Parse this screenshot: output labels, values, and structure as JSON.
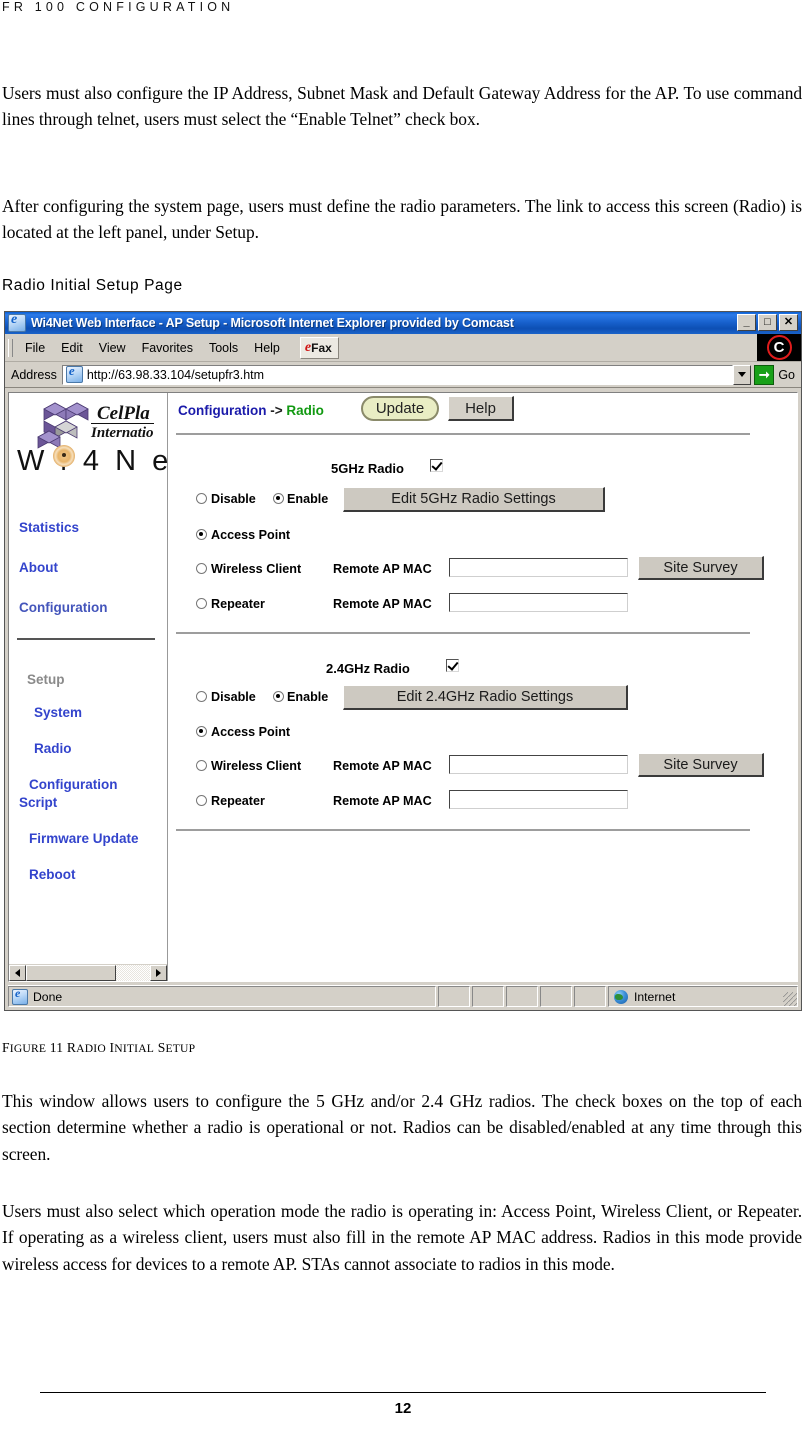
{
  "document": {
    "running_head": "FR 100 CONFIGURATION",
    "para1": "Users must also configure the IP Address, Subnet Mask and Default Gateway Address for the AP. To use command lines through telnet, users must select the “Enable Telnet” check box.",
    "para2": "After configuring the system page, users must define the radio parameters. The link to access this screen (Radio) is located at the left panel, under Setup.",
    "subhead": "Radio Initial Setup Page",
    "figure_caption_prefix": "F",
    "figure_caption": "IGURE 11 R",
    "figure_caption_full": "FIGURE 11 RADIO INITIAL SETUP",
    "para3": "This window allows users to configure the 5 GHz and/or 2.4 GHz radios. The check boxes on the top of each section determine whether a radio is operational or not. Radios can be disabled/enabled at any time through this screen.",
    "para4": "Users must also select which operation mode the radio is operating in: Access Point, Wireless Client, or Repeater. If operating as a wireless client, users must also fill in the remote AP MAC address. Radios in this mode provide wireless access for devices to a remote AP. STAs cannot associate to radios in this mode.",
    "page_number": "12"
  },
  "browser": {
    "title": "Wi4Net Web Interface - AP Setup - Microsoft Internet Explorer provided by Comcast",
    "window_buttons": {
      "minimize": "_",
      "maximize": "□",
      "close": "✕"
    },
    "menu": [
      {
        "label": "File",
        "mnemonic": "F"
      },
      {
        "label": "Edit",
        "mnemonic": "E"
      },
      {
        "label": "View",
        "mnemonic": "V"
      },
      {
        "label": "Favorites",
        "mnemonic": "a"
      },
      {
        "label": "Tools",
        "mnemonic": "T"
      },
      {
        "label": "Help",
        "mnemonic": "H"
      }
    ],
    "efax_button": {
      "e": "e",
      "label": "Fax"
    },
    "comcast_badge": "C",
    "address": {
      "label": "Address",
      "url": "http://63.98.33.104/setupfr3.htm",
      "go_label": "Go"
    },
    "status": {
      "message": "Done",
      "zone": "Internet"
    }
  },
  "sidebar": {
    "brand_line1": "CelPla",
    "brand_line2": "Internatio",
    "product": "W i 4 N e",
    "links": [
      {
        "label": "Statistics"
      },
      {
        "label": "About"
      },
      {
        "label": "Configuration"
      }
    ],
    "setup_heading": "Setup",
    "setup_links": [
      {
        "label": "System"
      },
      {
        "label": "Radio"
      },
      {
        "label": "Configuration"
      },
      {
        "label": "Script"
      },
      {
        "label": "Firmware Update"
      },
      {
        "label": "Reboot"
      }
    ]
  },
  "page": {
    "breadcrumb": {
      "part1": "Configuration",
      "arrow": " -> ",
      "part2": "Radio"
    },
    "update_button": "Update",
    "help_button": "Help",
    "sections": [
      {
        "title": "5GHz Radio",
        "checkbox_checked": true,
        "disable_label": "Disable",
        "enable_label": "Enable",
        "disable_selected": false,
        "enable_selected": true,
        "edit_button": "Edit 5GHz Radio Settings",
        "modes": [
          {
            "label": "Access Point",
            "selected": true,
            "mac_label": "",
            "has_mac": false,
            "has_survey": false
          },
          {
            "label": "Wireless Client",
            "selected": false,
            "mac_label": "Remote AP MAC",
            "has_mac": true,
            "has_survey": true,
            "mac_value": ""
          },
          {
            "label": "Repeater",
            "selected": false,
            "mac_label": "Remote AP MAC",
            "has_mac": true,
            "has_survey": false,
            "mac_value": ""
          }
        ],
        "site_survey_button": "Site Survey"
      },
      {
        "title": "2.4GHz Radio",
        "checkbox_checked": true,
        "disable_label": "Disable",
        "enable_label": "Enable",
        "disable_selected": false,
        "enable_selected": true,
        "edit_button": "Edit 2.4GHz Radio Settings",
        "modes": [
          {
            "label": "Access Point",
            "selected": true,
            "mac_label": "",
            "has_mac": false,
            "has_survey": false
          },
          {
            "label": "Wireless Client",
            "selected": false,
            "mac_label": "Remote AP MAC",
            "has_mac": true,
            "has_survey": true,
            "mac_value": ""
          },
          {
            "label": "Repeater",
            "selected": false,
            "mac_label": "Remote AP MAC",
            "has_mac": true,
            "has_survey": false,
            "mac_value": ""
          }
        ],
        "site_survey_button": "Site Survey"
      }
    ]
  },
  "colors": {
    "link": "#3344cc",
    "crumb_blue": "#1a1aaa",
    "crumb_green": "#119911",
    "update_bg": "#e9edc4",
    "titlebar_blue": "#1760cc"
  }
}
